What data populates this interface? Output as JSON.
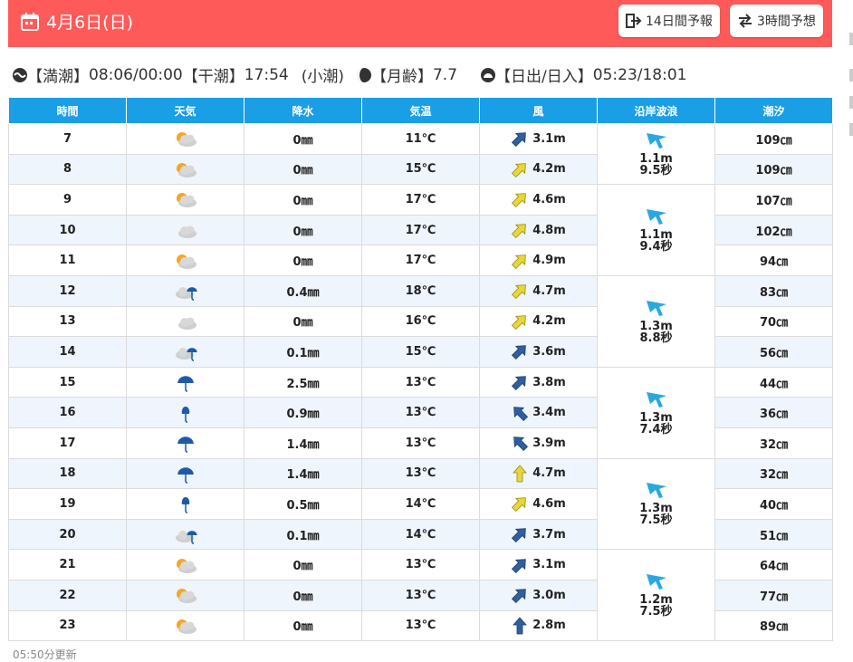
{
  "header": {
    "date": "4月6日(日)",
    "btn14": "14日間予報",
    "btn3": "3時間予想",
    "bg": "#ff5a5a"
  },
  "info": {
    "high_label": "【満潮】",
    "high_times": "08:06/00:00",
    "low_label": "【干潮】",
    "low_times": "17:54",
    "tide_type": "(小潮)",
    "moon_label": "【月齢】",
    "moon_age": "7.7",
    "sun_label": "【日出/日入】",
    "sun_times": "05:23/18:01"
  },
  "columns": [
    "時間",
    "天気",
    "降水",
    "気温",
    "風",
    "沿岸波浪",
    "潮汐"
  ],
  "rows": [
    {
      "hour": "7",
      "weather": "sun-cloud",
      "rain": "0㎜",
      "temp": "11℃",
      "wind_dir": "ne",
      "wind_color": "blue",
      "wind": "3.1m",
      "tide": "109㎝"
    },
    {
      "hour": "8",
      "weather": "sun-cloud",
      "rain": "0㎜",
      "temp": "15℃",
      "wind_dir": "ne",
      "wind_color": "yellow",
      "wind": "4.2m",
      "tide": "109㎝"
    },
    {
      "hour": "9",
      "weather": "sun-cloud",
      "rain": "0㎜",
      "temp": "17℃",
      "wind_dir": "ne",
      "wind_color": "yellow",
      "wind": "4.6m",
      "tide": "107㎝"
    },
    {
      "hour": "10",
      "weather": "cloud",
      "rain": "0㎜",
      "temp": "17℃",
      "wind_dir": "ne",
      "wind_color": "yellow",
      "wind": "4.8m",
      "tide": "102㎝"
    },
    {
      "hour": "11",
      "weather": "sun-cloud",
      "rain": "0㎜",
      "temp": "17℃",
      "wind_dir": "ne",
      "wind_color": "yellow",
      "wind": "4.9m",
      "tide": "94㎝"
    },
    {
      "hour": "12",
      "weather": "cloud-rain",
      "rain": "0.4㎜",
      "temp": "18℃",
      "wind_dir": "ne",
      "wind_color": "yellow",
      "wind": "4.7m",
      "tide": "83㎝"
    },
    {
      "hour": "13",
      "weather": "cloud",
      "rain": "0㎜",
      "temp": "16℃",
      "wind_dir": "ne",
      "wind_color": "yellow",
      "wind": "4.2m",
      "tide": "70㎝"
    },
    {
      "hour": "14",
      "weather": "cloud-rain",
      "rain": "0.1㎜",
      "temp": "15℃",
      "wind_dir": "ne",
      "wind_color": "blue",
      "wind": "3.6m",
      "tide": "56㎝"
    },
    {
      "hour": "15",
      "weather": "umbrella",
      "rain": "2.5㎜",
      "temp": "13℃",
      "wind_dir": "ne",
      "wind_color": "blue",
      "wind": "3.8m",
      "tide": "44㎝"
    },
    {
      "hour": "16",
      "weather": "umbrella-small",
      "rain": "0.9㎜",
      "temp": "13℃",
      "wind_dir": "nw",
      "wind_color": "blue",
      "wind": "3.4m",
      "tide": "36㎝"
    },
    {
      "hour": "17",
      "weather": "umbrella",
      "rain": "1.4㎜",
      "temp": "13℃",
      "wind_dir": "nw",
      "wind_color": "blue",
      "wind": "3.9m",
      "tide": "32㎝"
    },
    {
      "hour": "18",
      "weather": "umbrella",
      "rain": "1.4㎜",
      "temp": "13℃",
      "wind_dir": "n",
      "wind_color": "yellow",
      "wind": "4.7m",
      "tide": "32㎝"
    },
    {
      "hour": "19",
      "weather": "umbrella-small",
      "rain": "0.5㎜",
      "temp": "14℃",
      "wind_dir": "ne",
      "wind_color": "yellow",
      "wind": "4.6m",
      "tide": "40㎝"
    },
    {
      "hour": "20",
      "weather": "cloud-rain",
      "rain": "0.1㎜",
      "temp": "14℃",
      "wind_dir": "ne",
      "wind_color": "blue",
      "wind": "3.7m",
      "tide": "51㎝"
    },
    {
      "hour": "21",
      "weather": "sun-cloud",
      "rain": "0㎜",
      "temp": "13℃",
      "wind_dir": "ne",
      "wind_color": "blue",
      "wind": "3.1m",
      "tide": "64㎝"
    },
    {
      "hour": "22",
      "weather": "sun-cloud",
      "rain": "0㎜",
      "temp": "13℃",
      "wind_dir": "ne",
      "wind_color": "blue",
      "wind": "3.0m",
      "tide": "77㎝"
    },
    {
      "hour": "23",
      "weather": "sun-cloud",
      "rain": "0㎜",
      "temp": "13℃",
      "wind_dir": "n",
      "wind_color": "blue",
      "wind": "2.8m",
      "tide": "89㎝"
    }
  ],
  "waves": [
    {
      "height": "1.1m",
      "period": "9.5秒"
    },
    {
      "height": "1.1m",
      "period": "9.4秒"
    },
    {
      "height": "1.3m",
      "period": "8.8秒"
    },
    {
      "height": "1.3m",
      "period": "7.4秒"
    },
    {
      "height": "1.3m",
      "period": "7.5秒"
    },
    {
      "height": "1.2m",
      "period": "7.5秒"
    }
  ],
  "footer": "05:50分更新",
  "colors": {
    "header_th": "#1a9ee6",
    "alt_row": "#eef5fc",
    "wind_blue": "#2f5f9e",
    "wind_yellow": "#e8d63a",
    "wave_arrow": "#29a8e0"
  }
}
